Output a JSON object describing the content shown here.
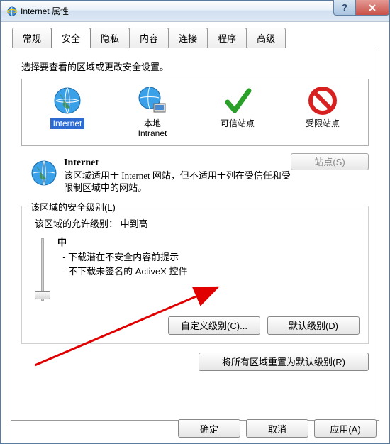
{
  "window": {
    "title": "Internet 属性"
  },
  "tabs": {
    "items": [
      {
        "label": "常规"
      },
      {
        "label": "安全"
      },
      {
        "label": "隐私"
      },
      {
        "label": "内容"
      },
      {
        "label": "连接"
      },
      {
        "label": "程序"
      },
      {
        "label": "高级"
      }
    ],
    "active": 1
  },
  "instruction": "选择要查看的区域或更改安全设置。",
  "zones": [
    {
      "label": "Internet",
      "selected": true,
      "kind": "globe"
    },
    {
      "label": "本地\nIntranet",
      "selected": false,
      "kind": "local"
    },
    {
      "label": "可信站点",
      "selected": false,
      "kind": "trusted"
    },
    {
      "label": "受限站点",
      "selected": false,
      "kind": "restricted"
    }
  ],
  "zone_detail": {
    "title": "Internet",
    "body": "该区域适用于 Internet 网站，但不适用于列在受信任和受限制区域中的网站。",
    "sites_button": "站点(S)"
  },
  "security": {
    "legend": "该区域的安全级别(L)",
    "allowed_label": "该区域的允许级别：",
    "allowed_value": "中到高",
    "current_level": "中",
    "bullets": [
      "下载潜在不安全内容前提示",
      "不下载未签名的 ActiveX 控件"
    ],
    "custom_button": "自定义级别(C)...",
    "default_button": "默认级别(D)",
    "reset_button": "将所有区域重置为默认级别(R)"
  },
  "footer": {
    "ok": "确定",
    "cancel": "取消",
    "apply": "应用(A)"
  }
}
